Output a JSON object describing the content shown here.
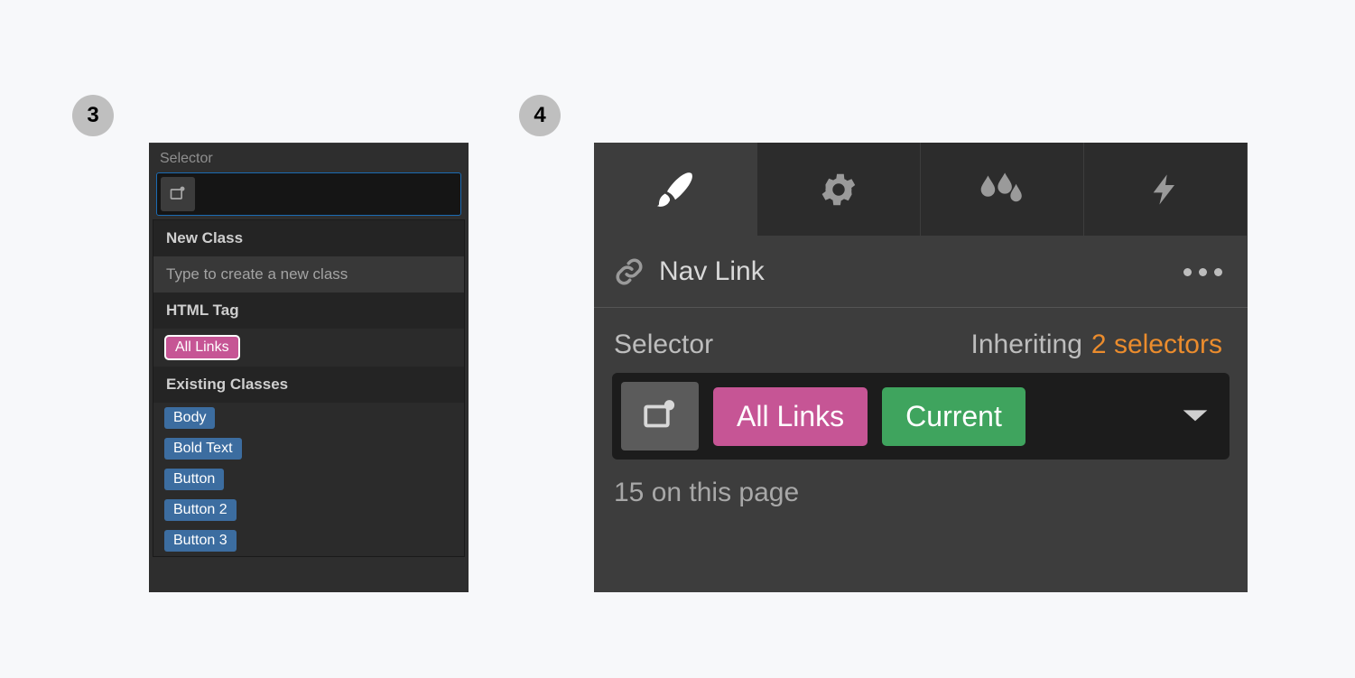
{
  "step3": {
    "badge": "3",
    "selector_label": "Selector",
    "groups": {
      "new_class": {
        "title": "New Class",
        "hint": "Type to create a new class"
      },
      "html_tag": {
        "title": "HTML Tag",
        "items": [
          "All Links"
        ]
      },
      "existing": {
        "title": "Existing Classes",
        "items": [
          "Body",
          "Bold Text",
          "Button",
          "Button 2",
          "Button 3"
        ]
      }
    }
  },
  "step4": {
    "badge": "4",
    "element_name": "Nav Link",
    "selector_label": "Selector",
    "inheriting_label": "Inheriting",
    "inheriting_count": "2 selectors",
    "tags": {
      "html_tag": "All Links",
      "state": "Current"
    },
    "page_count": "15 on this page"
  }
}
